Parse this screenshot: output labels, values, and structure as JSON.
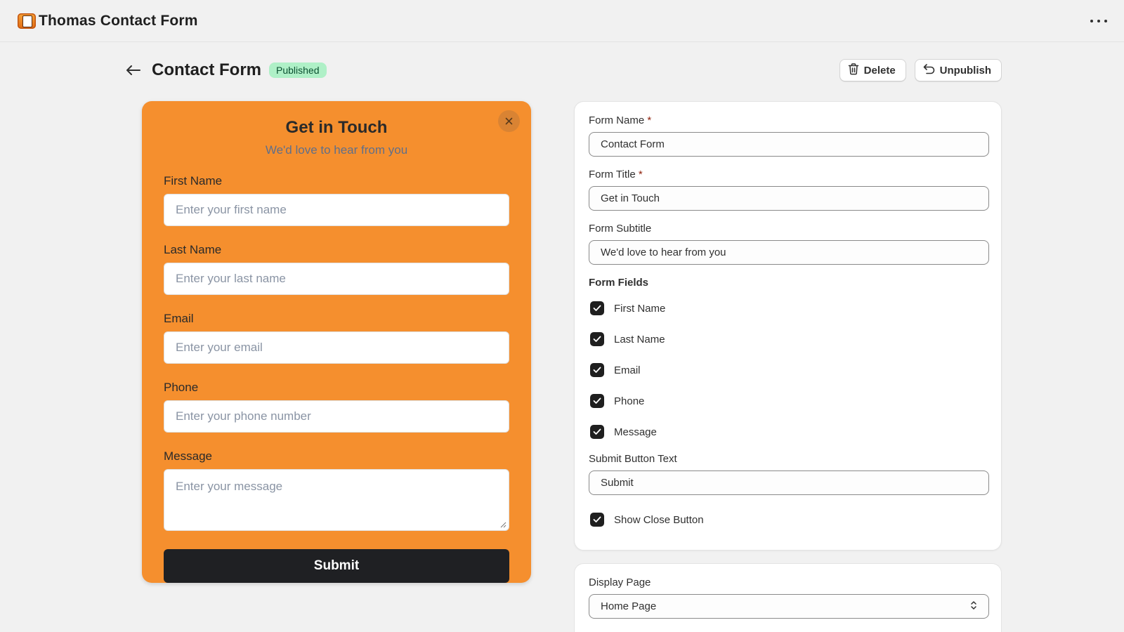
{
  "app": {
    "title": "Thomas Contact Form"
  },
  "header": {
    "title": "Contact Form",
    "status": "Published",
    "delete_label": "Delete",
    "unpublish_label": "Unpublish"
  },
  "preview": {
    "title": "Get in Touch",
    "subtitle": "We'd love to hear from you",
    "fields": [
      {
        "label": "First Name",
        "placeholder": "Enter your first name"
      },
      {
        "label": "Last Name",
        "placeholder": "Enter your last name"
      },
      {
        "label": "Email",
        "placeholder": "Enter your email"
      },
      {
        "label": "Phone",
        "placeholder": "Enter your phone number"
      },
      {
        "label": "Message",
        "placeholder": "Enter your message"
      }
    ],
    "submit_label": "Submit",
    "background_color": "#f58f2e"
  },
  "settings": {
    "form_name": {
      "label": "Form Name",
      "required": "*",
      "value": "Contact Form"
    },
    "form_title": {
      "label": "Form Title",
      "required": "*",
      "value": "Get in Touch"
    },
    "form_subtitle": {
      "label": "Form Subtitle",
      "value": "We'd love to hear from you"
    },
    "form_fields_heading": "Form Fields",
    "form_fields": [
      {
        "label": "First Name",
        "checked": true
      },
      {
        "label": "Last Name",
        "checked": true
      },
      {
        "label": "Email",
        "checked": true
      },
      {
        "label": "Phone",
        "checked": true
      },
      {
        "label": "Message",
        "checked": true
      }
    ],
    "submit_text": {
      "label": "Submit Button Text",
      "value": "Submit"
    },
    "show_close": {
      "label": "Show Close Button",
      "checked": true
    }
  },
  "display": {
    "label": "Display Page",
    "selected": "Home Page"
  }
}
